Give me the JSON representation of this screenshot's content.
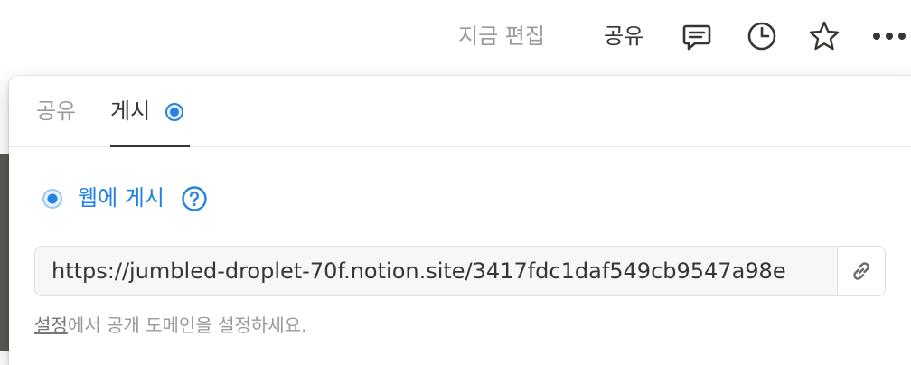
{
  "topbar": {
    "edited_label": "지금 편집",
    "share_label": "공유",
    "icons": [
      "comment-icon",
      "clock-icon",
      "star-icon",
      "more-icon"
    ]
  },
  "popover": {
    "tabs": [
      {
        "label": "공유",
        "active": false
      },
      {
        "label": "게시",
        "active": true
      }
    ],
    "publish": {
      "web_label": "웹에 게시",
      "url": "https://jumbled-droplet-70f.notion.site/3417fdc1daf549cb9547a98e",
      "hint_link": "설정",
      "hint_rest": "에서 공개 도메인을 설정하세요."
    }
  },
  "colors": {
    "accent": "#2383e2",
    "text": "#37352f",
    "muted": "#9b9a97"
  }
}
